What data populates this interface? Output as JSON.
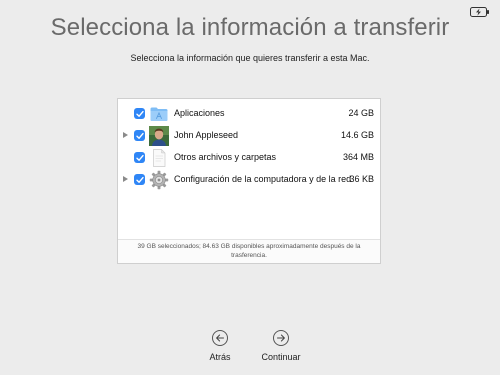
{
  "title": "Selecciona la información a transferir",
  "subtitle": "Selecciona la información que quieres transferir a esta Mac.",
  "items": [
    {
      "label": "Aplicaciones",
      "size": "24 GB",
      "icon": "applications-folder-icon",
      "expandable": false,
      "checked": true
    },
    {
      "label": "John Appleseed",
      "size": "14.6 GB",
      "icon": "user-avatar-icon",
      "expandable": true,
      "checked": true
    },
    {
      "label": "Otros archivos y carpetas",
      "size": "364 MB",
      "icon": "document-icon",
      "expandable": false,
      "checked": true
    },
    {
      "label": "Configuración de la computadora y de la red",
      "size": "36 KB",
      "icon": "gear-icon",
      "expandable": true,
      "checked": true
    }
  ],
  "summary": "39 GB seleccionados; 84.63 GB disponibles aproximadamente después de la trasferencia.",
  "nav": {
    "back_label": "Atrás",
    "continue_label": "Continuar"
  },
  "colors": {
    "background": "#ececec",
    "checkbox_blue": "#2f86f6",
    "title_gray": "#6a6a6a"
  },
  "status": {
    "battery_icon": "battery-charging-icon"
  }
}
